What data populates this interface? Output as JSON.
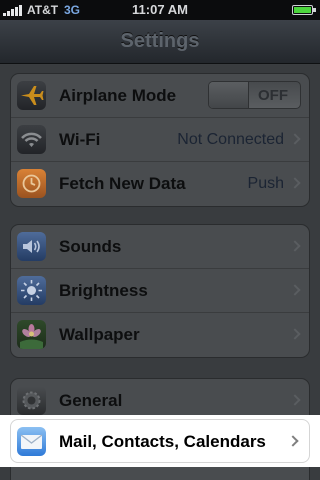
{
  "status_bar": {
    "carrier": "AT&T",
    "network": "3G",
    "time": "11:07 AM",
    "signal_bars": 5,
    "battery_level": 1.0
  },
  "navbar": {
    "title": "Settings"
  },
  "groups": [
    {
      "rows": [
        {
          "label": "Airplane Mode",
          "icon": "airplane-icon",
          "control": "toggle",
          "toggle_label": "OFF",
          "toggle_on": false
        },
        {
          "label": "Wi-Fi",
          "icon": "wifi-icon",
          "value": "Not Connected",
          "control": "disclosure"
        },
        {
          "label": "Fetch New Data",
          "icon": "fetch-clock-icon",
          "value": "Push",
          "control": "disclosure"
        }
      ]
    },
    {
      "rows": [
        {
          "label": "Sounds",
          "icon": "speaker-icon",
          "control": "disclosure"
        },
        {
          "label": "Brightness",
          "icon": "sun-icon",
          "control": "disclosure"
        },
        {
          "label": "Wallpaper",
          "icon": "flower-icon",
          "control": "disclosure"
        }
      ]
    },
    {
      "rows": [
        {
          "label": "General",
          "icon": "gear-icon",
          "control": "disclosure"
        },
        {
          "label": "Mail, Contacts, Calendars",
          "icon": "mail-icon",
          "control": "disclosure",
          "highlighted": true
        }
      ]
    }
  ],
  "colors": {
    "background": "#393c3f",
    "cell": "#494c4f",
    "value_text": "#1b2433",
    "highlight": "#ffffff",
    "network_3g": "#7aa7e0"
  }
}
